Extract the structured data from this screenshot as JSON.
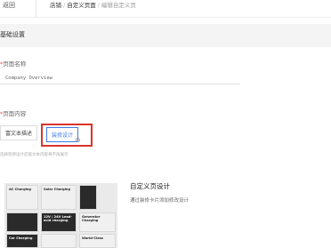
{
  "header": {
    "back_label": "返回",
    "breadcrumb": [
      "店铺",
      "自定义页面",
      "编辑自定义页"
    ]
  },
  "section": {
    "title": "基础设置"
  },
  "form": {
    "name_label": "页面名称",
    "name_value": "Company Overview",
    "content_label": "页面内容",
    "options": [
      "富文本描述",
      "装修设计"
    ],
    "selected_option": "装修设计",
    "hint": "选择装修设计后富文本内容将不再展示"
  },
  "preview": {
    "tiles": [
      {
        "text": "AC Charging",
        "theme": "light"
      },
      {
        "text": "Solar Charging",
        "theme": "light"
      },
      {
        "text": "",
        "theme": "dark"
      },
      {
        "text": "",
        "theme": "dark"
      },
      {
        "text": "12V / 24V Lead-acid charging",
        "theme": "dark"
      },
      {
        "text": "Generator Charging",
        "theme": "light"
      },
      {
        "text": "Car Charging",
        "theme": "dark"
      },
      {
        "text": "",
        "theme": "light"
      },
      {
        "text": "World-Class",
        "theme": "light"
      }
    ]
  },
  "design": {
    "title": "自定义页设计",
    "description": "通过装修卡片添加修改设计"
  },
  "colors": {
    "accent": "#3f7bea",
    "highlight_box": "#d9342b",
    "required": "#e34d4d"
  }
}
